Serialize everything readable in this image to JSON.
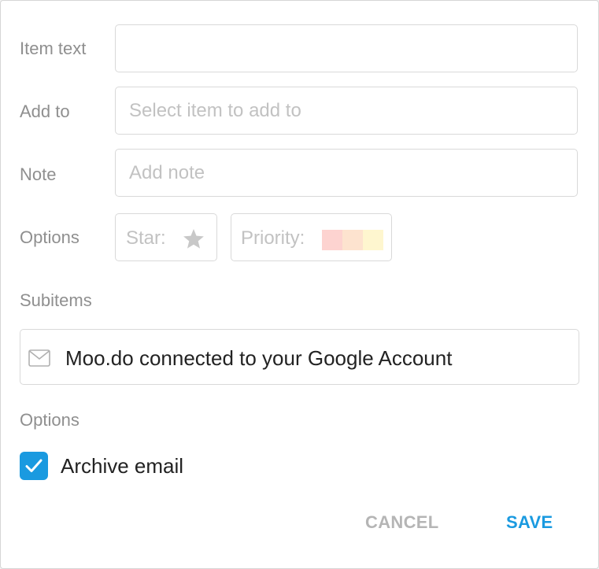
{
  "form": {
    "item_text": {
      "label": "Item text",
      "value": "",
      "placeholder": ""
    },
    "add_to": {
      "label": "Add to",
      "value": "",
      "placeholder": "Select item to add to"
    },
    "note": {
      "label": "Note",
      "value": "",
      "placeholder": "Add note"
    },
    "options": {
      "label": "Options",
      "star_label": "Star:",
      "star_icon": "star-icon",
      "priority_label": "Priority:",
      "priority_colors": [
        "#fdd3d0",
        "#fde3cf",
        "#fef6cf"
      ]
    }
  },
  "subitems": {
    "label": "Subitems",
    "items": [
      {
        "icon": "envelope-icon",
        "text": "Moo.do connected to your Google Account"
      }
    ]
  },
  "email_options": {
    "label": "Options",
    "archive_email": {
      "label": "Archive email",
      "checked": true
    }
  },
  "actions": {
    "cancel_label": "CANCEL",
    "save_label": "SAVE"
  },
  "colors": {
    "accent": "#1a9ae0",
    "cancel": "#b5b5b5",
    "label": "#8f8f8f",
    "placeholder": "#c2c2c2"
  }
}
